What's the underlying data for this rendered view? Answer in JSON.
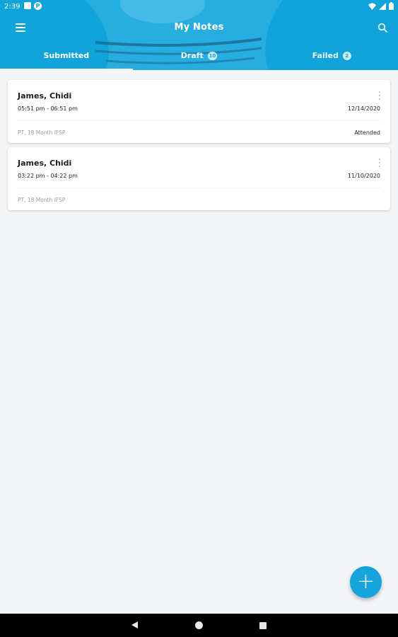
{
  "status_bar": {
    "time": "2:39",
    "left_icons": [
      "sim-card-icon",
      "p-app-icon"
    ],
    "right_icons": [
      "wifi-icon",
      "signal-icon",
      "battery-icon"
    ]
  },
  "header": {
    "title": "My Notes",
    "menu_icon": "hamburger-menu-icon",
    "search_icon": "search-icon"
  },
  "tabs": [
    {
      "label": "Submitted",
      "badge": null,
      "active": true
    },
    {
      "label": "Draft",
      "badge": "10",
      "active": false
    },
    {
      "label": "Failed",
      "badge": "2",
      "active": false
    }
  ],
  "notes": [
    {
      "name": "James, Chidi",
      "time_range": "05:51 pm - 06:51 pm",
      "date": "12/14/2020",
      "type": "PT, 18 Month IFSP",
      "status": "Attended"
    },
    {
      "name": "James, Chidi",
      "time_range": "03:22 pm - 04:22 pm",
      "date": "11/10/2020",
      "type": "PT, 18 Month IFSP",
      "status": ""
    }
  ],
  "fab": {
    "symbol": "+",
    "icon": "add-icon"
  },
  "nav": {
    "back": "back-icon",
    "home": "home-icon",
    "recent": "recent-apps-icon"
  },
  "colors": {
    "accent": "#15a4dc",
    "background": "#f4f5f7"
  }
}
